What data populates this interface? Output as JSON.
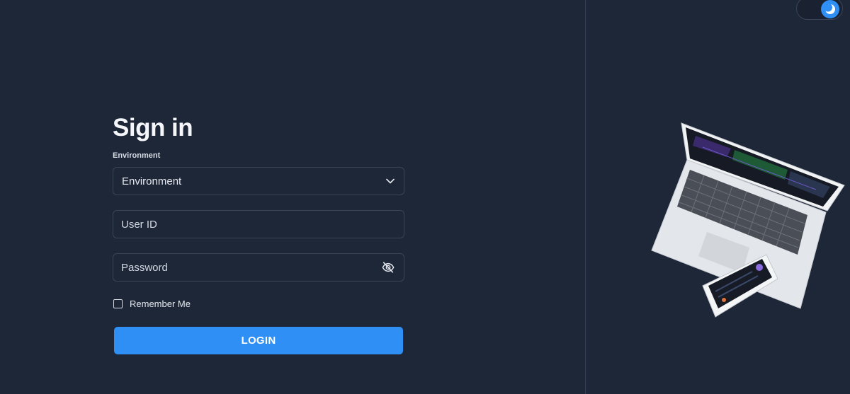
{
  "signin": {
    "title": "Sign in",
    "environment_label": "Environment",
    "environment_value": "Environment",
    "userid_placeholder": "User ID",
    "password_placeholder": "Password",
    "remember_label": "Remember Me",
    "login_label": "LOGIN"
  },
  "theme_toggle": {
    "mode": "dark",
    "icon": "moon-icon"
  },
  "colors": {
    "background": "#1e2738",
    "accent": "#2f8ff5",
    "border": "#3a4458"
  }
}
